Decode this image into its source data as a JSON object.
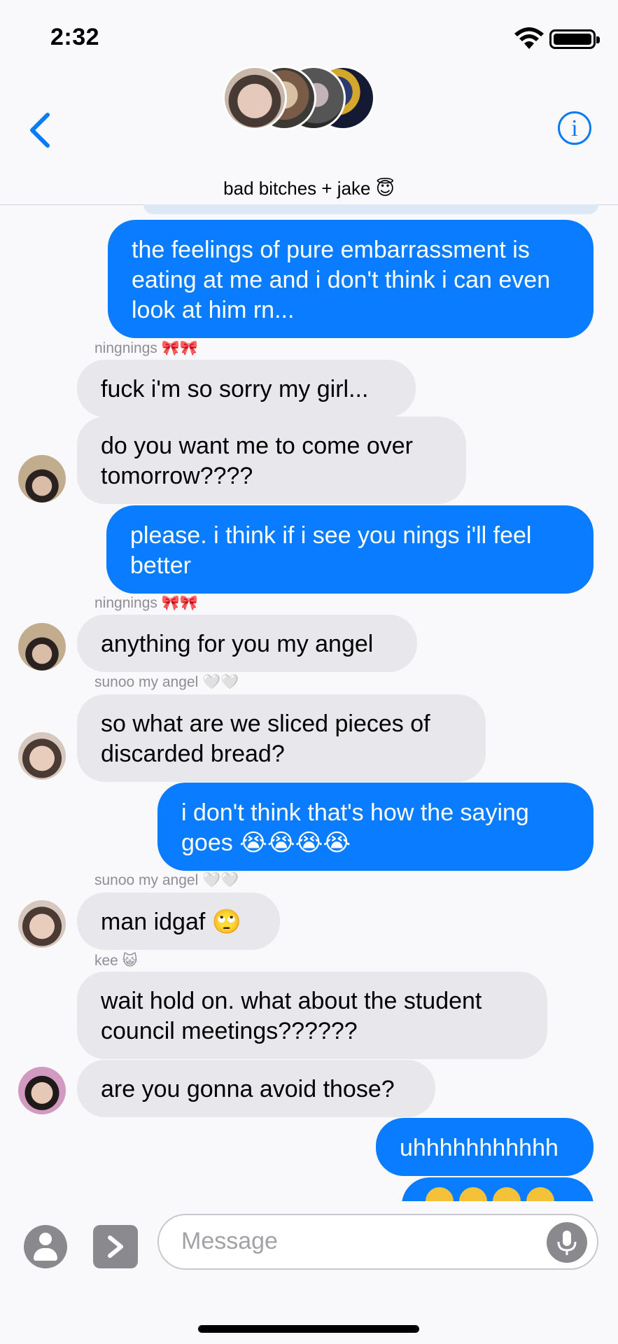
{
  "status_bar": {
    "time": "2:32"
  },
  "header": {
    "group_name": "bad bitches + jake 😇"
  },
  "composer": {
    "placeholder": "Message"
  },
  "messages": [
    {
      "text": "the feelings of pure embarrassment is eating at me and i don't think i can even look at him rn..."
    },
    {
      "sender": "ningnings 🎀🎀",
      "text": "fuck i'm so sorry my girl..."
    },
    {
      "text": "do you want me to come over tomorrow????"
    },
    {
      "text": "please. i think if i see you nings i'll feel better"
    },
    {
      "sender": "ningnings 🎀🎀",
      "text": "anything for you my angel"
    },
    {
      "sender": "sunoo my angel 🤍🤍",
      "text": "so what are we sliced pieces of discarded bread?"
    },
    {
      "text": "i don't think that's how the saying goes 😭😭😭😭"
    },
    {
      "sender": "sunoo my angel 🤍🤍",
      "text": "man idgaf 🙄"
    },
    {
      "sender": "kee 😺",
      "text": "wait hold on. what about the student council meetings??????"
    },
    {
      "text": "are you gonna avoid those?"
    },
    {
      "text": "uhhhhhhhhhhh"
    }
  ]
}
